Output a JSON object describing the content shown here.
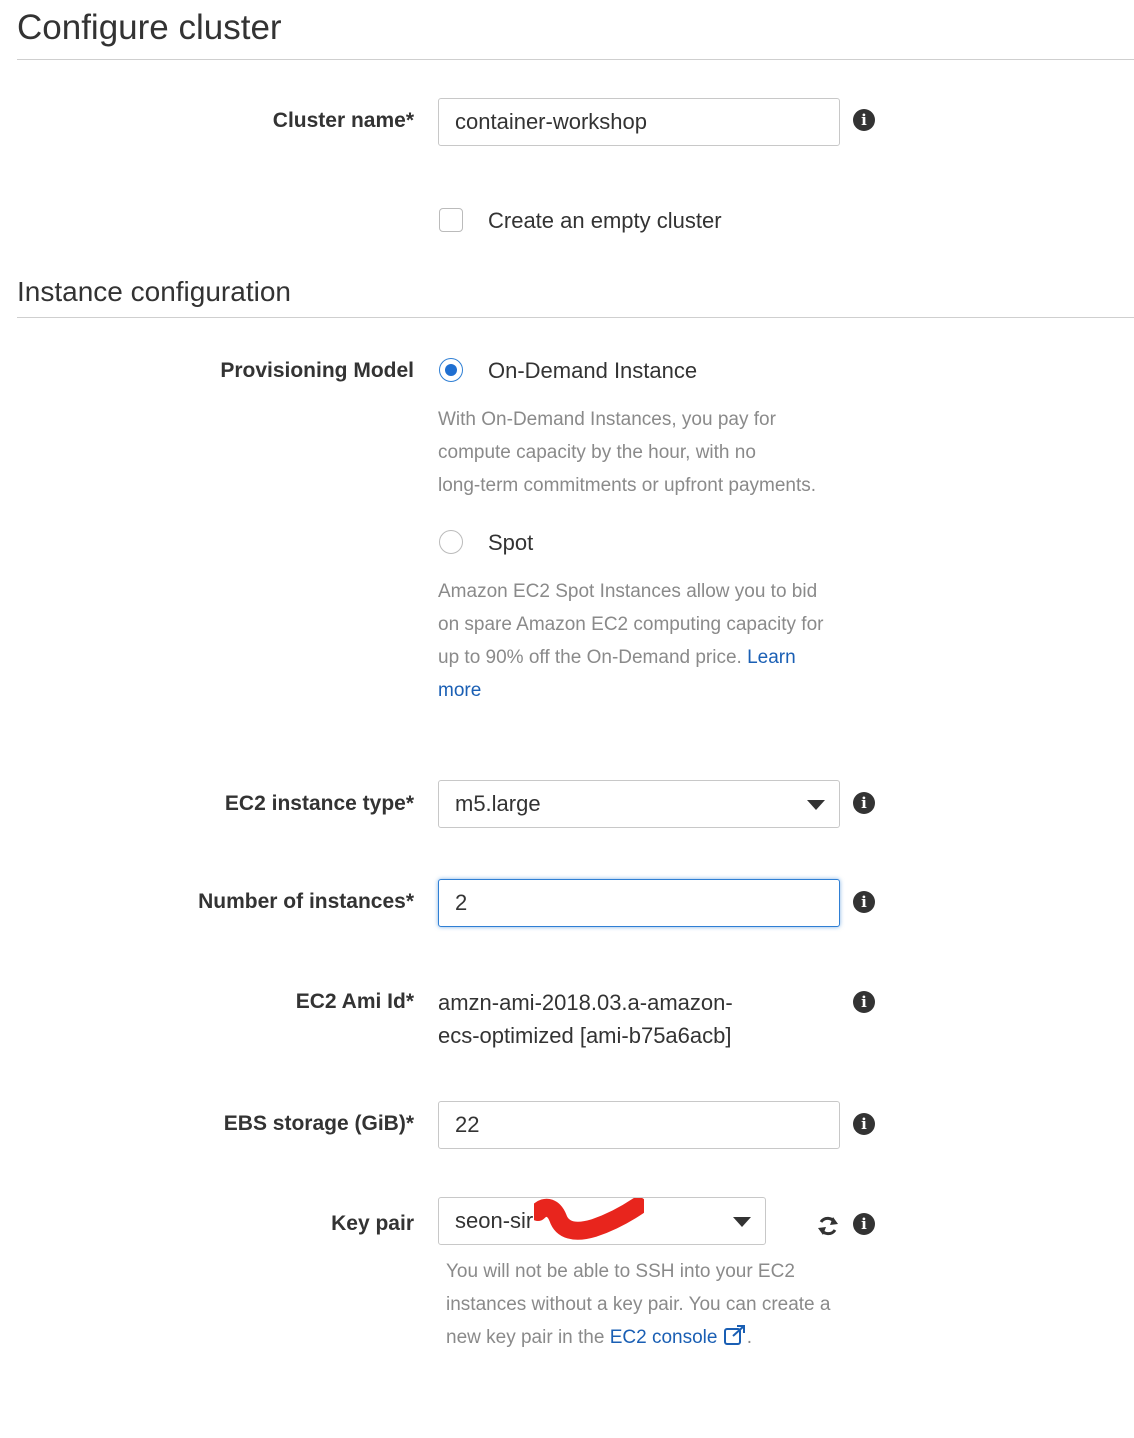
{
  "page": {
    "title": "Configure cluster"
  },
  "cluster": {
    "name_label": "Cluster name*",
    "name_value": "container-workshop",
    "empty_cluster_label": "Create an empty cluster",
    "empty_cluster_checked": false
  },
  "instance_config": {
    "title": "Instance configuration",
    "provisioning_label": "Provisioning Model",
    "on_demand_label": "On-Demand Instance",
    "on_demand_help_1": "With On-Demand Instances, you pay for",
    "on_demand_help_2": "compute capacity by the hour, with no",
    "on_demand_help_3": "long-term commitments or upfront payments.",
    "spot_label": "Spot",
    "spot_help_1": "Amazon EC2 Spot Instances allow you to bid",
    "spot_help_2": "on spare Amazon EC2 computing capacity for",
    "spot_help_3": "up to 90% off the On-Demand price.",
    "learn_more_1": "Learn",
    "learn_more_2": "more",
    "selected_model": "On-Demand Instance",
    "instance_type_label": "EC2 instance type*",
    "instance_type_value": "m5.large",
    "num_instances_label": "Number of instances*",
    "num_instances_value": "2",
    "ami_label": "EC2 Ami Id*",
    "ami_value_1": "amzn-ami-2018.03.a-amazon-",
    "ami_value_2": "ecs-optimized [ami-b75a6acb]",
    "ebs_label": "EBS storage (GiB)*",
    "ebs_value": "22",
    "key_pair_label": "Key pair",
    "key_pair_value": "seon-sir",
    "key_help_1": "You will not be able to SSH into your EC2",
    "key_help_2": "instances without a key pair. You can create a",
    "key_help_3": "new key pair in the",
    "ec2_console_link": "EC2 console",
    "key_help_end": "."
  },
  "colors": {
    "accent": "#1f6fd1",
    "link": "#1a5fb4",
    "help_text": "#8a8a8a",
    "redaction": "#e8251d"
  },
  "icons": [
    "info-icon",
    "refresh-icon",
    "external-link-icon",
    "chevron-down-icon"
  ]
}
